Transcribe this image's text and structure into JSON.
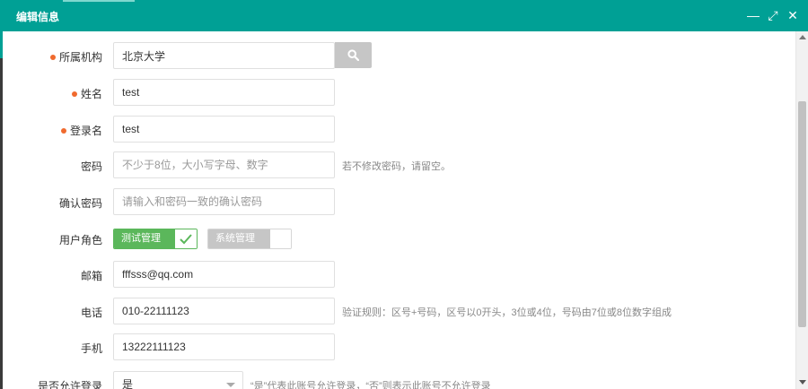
{
  "window": {
    "title": "编辑信息",
    "controls": {
      "minimize": "—",
      "maximize": "⤢",
      "close": "✕"
    }
  },
  "form": {
    "org": {
      "label": "所属机构",
      "value": "北京大学",
      "required": true
    },
    "name": {
      "label": "姓名",
      "value": "test",
      "required": true
    },
    "login": {
      "label": "登录名",
      "value": "test",
      "required": true
    },
    "password": {
      "label": "密码",
      "placeholder": "不少于8位，大小写字母、数字",
      "hint": "若不修改密码，请留空。"
    },
    "confirm": {
      "label": "确认密码",
      "placeholder": "请输入和密码一致的确认密码"
    },
    "roles": {
      "label": "用户角色",
      "items": [
        {
          "name": "测试管理员",
          "selected": true
        },
        {
          "name": "系统管理员",
          "selected": false
        }
      ]
    },
    "email": {
      "label": "邮箱",
      "value": "fffsss@qq.com"
    },
    "phone": {
      "label": "电话",
      "value": "010-22111123",
      "hint": "验证规则：区号+号码，区号以0开头，3位或4位，号码由7位或8位数字组成"
    },
    "mobile": {
      "label": "手机",
      "value": "13222111123"
    },
    "allow_login": {
      "label": "是否允许登录",
      "value": "是",
      "hint": "“是”代表此账号允许登录，“否”则表示此账号不允许登录"
    }
  },
  "colors": {
    "accent": "#00a095",
    "required_dot": "#f06a2e",
    "selected_role": "#5bb75b"
  }
}
